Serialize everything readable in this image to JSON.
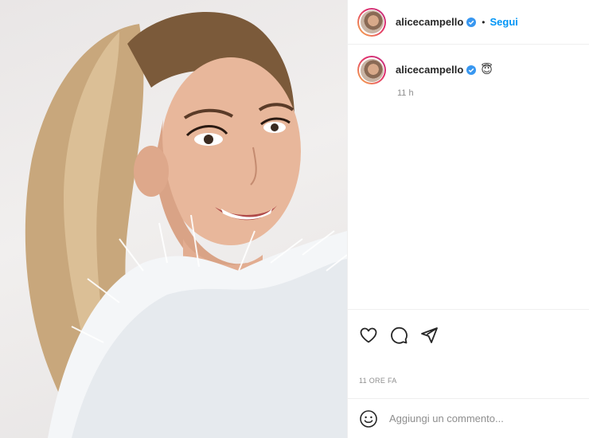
{
  "post": {
    "username": "alicecampello",
    "follow_label": "Segui",
    "separator": "•",
    "caption_emoji": "😇",
    "caption_time": "11 h",
    "posted_ago": "11 ORE FA",
    "comment_placeholder": "Aggiungi un commento..."
  },
  "icons": {
    "verified": "verified-badge-icon",
    "like": "heart-icon",
    "comment": "comment-bubble-icon",
    "share": "paper-plane-icon",
    "emoji": "smiley-icon"
  },
  "colors": {
    "link": "#0095f6",
    "verified": "#3897f0",
    "muted": "#8e8e8e",
    "text": "#262626"
  }
}
